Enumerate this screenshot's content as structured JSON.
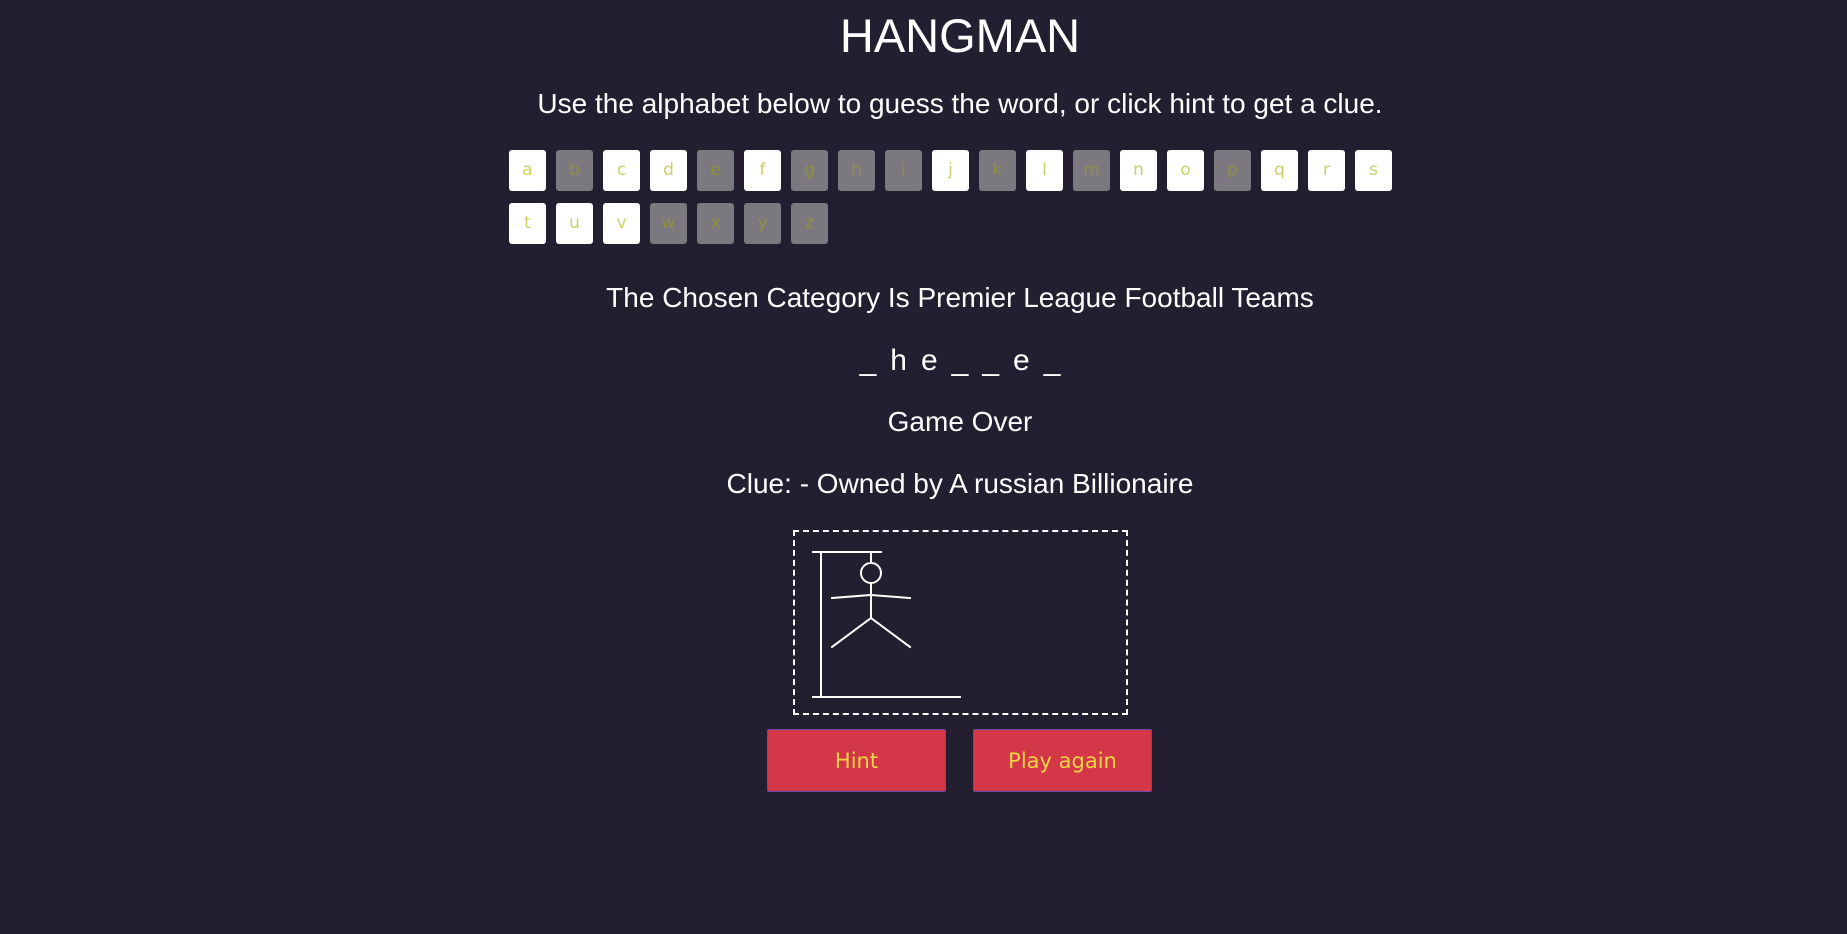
{
  "header": {
    "title": "HANGMAN",
    "instructions": "Use the alphabet below to guess the word, or click hint to get a clue."
  },
  "alphabet": [
    {
      "letter": "a",
      "used": false
    },
    {
      "letter": "b",
      "used": true
    },
    {
      "letter": "c",
      "used": false
    },
    {
      "letter": "d",
      "used": false
    },
    {
      "letter": "e",
      "used": true
    },
    {
      "letter": "f",
      "used": false
    },
    {
      "letter": "g",
      "used": true
    },
    {
      "letter": "h",
      "used": true
    },
    {
      "letter": "i",
      "used": true
    },
    {
      "letter": "j",
      "used": false
    },
    {
      "letter": "k",
      "used": true
    },
    {
      "letter": "l",
      "used": false
    },
    {
      "letter": "m",
      "used": true
    },
    {
      "letter": "n",
      "used": false
    },
    {
      "letter": "o",
      "used": false
    },
    {
      "letter": "p",
      "used": true
    },
    {
      "letter": "q",
      "used": false
    },
    {
      "letter": "r",
      "used": false
    },
    {
      "letter": "s",
      "used": false
    },
    {
      "letter": "t",
      "used": false
    },
    {
      "letter": "u",
      "used": false
    },
    {
      "letter": "v",
      "used": false
    },
    {
      "letter": "w",
      "used": true
    },
    {
      "letter": "x",
      "used": true
    },
    {
      "letter": "y",
      "used": true
    },
    {
      "letter": "z",
      "used": true
    }
  ],
  "game": {
    "category": "The Chosen Category Is Premier League Football Teams",
    "word_slots": [
      "_",
      "h",
      "e",
      "_",
      "_",
      "e",
      "_"
    ],
    "status": "Game Over",
    "clue": "Clue: - Owned by A russian Billionaire"
  },
  "buttons": {
    "hint_label": "Hint",
    "reset_label": "Play again"
  },
  "colors": {
    "background": "#241e31",
    "letter_available_bg": "#ffffff",
    "letter_used_bg": "#7b7880",
    "letter_text": "#c9d16a",
    "button_bg": "#d43747",
    "button_text": "#f2d447"
  }
}
